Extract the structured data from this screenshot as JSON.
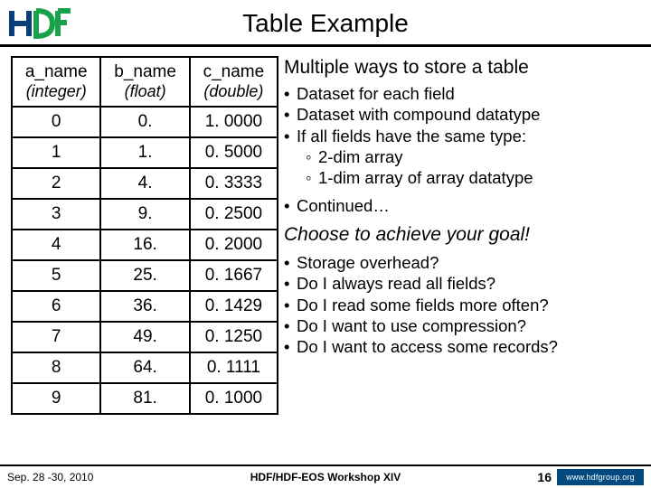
{
  "title": "Table Example",
  "chart_data": {
    "type": "table",
    "columns": [
      {
        "name": "a_name",
        "dtype": "(integer)"
      },
      {
        "name": "b_name",
        "dtype": "(float)"
      },
      {
        "name": "c_name",
        "dtype": "(double)"
      }
    ],
    "rows": [
      [
        "0",
        "0.",
        "1. 0000"
      ],
      [
        "1",
        "1.",
        "0. 5000"
      ],
      [
        "2",
        "4.",
        "0. 3333"
      ],
      [
        "3",
        "9.",
        "0. 2500"
      ],
      [
        "4",
        "16.",
        "0. 2000"
      ],
      [
        "5",
        "25.",
        "0. 1667"
      ],
      [
        "6",
        "36.",
        "0. 1429"
      ],
      [
        "7",
        "49.",
        "0. 1250"
      ],
      [
        "8",
        "64.",
        "0. 1111"
      ],
      [
        "9",
        "81.",
        "0. 1000"
      ]
    ]
  },
  "right": {
    "heading1": "Multiple ways to store a table",
    "b1": "Dataset for each field",
    "b2": "Dataset with compound datatype",
    "b3": "If all fields have the same type:",
    "b3a": "2-dim array",
    "b3b": "1-dim array of array datatype",
    "b4": "Continued…",
    "goal": "Choose to achieve your goal!",
    "q1": "Storage overhead?",
    "q2": "Do I always read all fields?",
    "q3": "Do I read some fields more often?",
    "q4": "Do I want to use compression?",
    "q5": "Do I want to access some records?"
  },
  "footer": {
    "date": "Sep. 28 -30, 2010",
    "venue": "HDF/HDF-EOS Workshop XIV",
    "page": "16",
    "group": "www.hdfgroup.org"
  }
}
